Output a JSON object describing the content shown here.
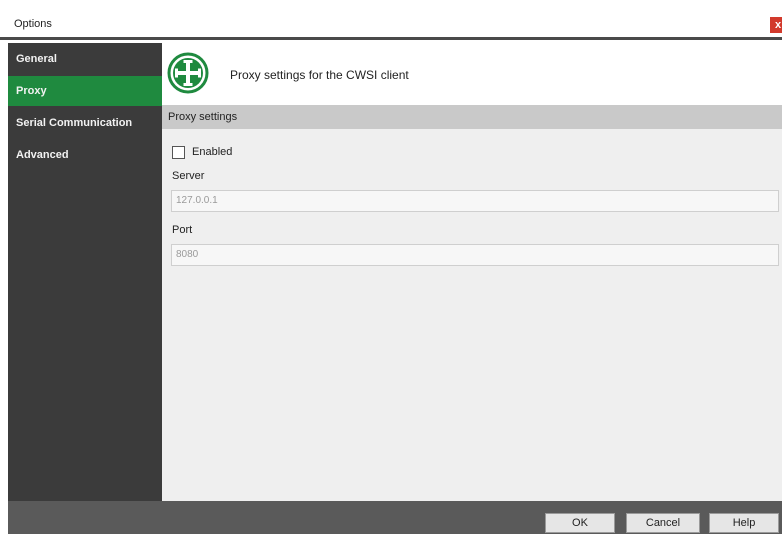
{
  "window": {
    "title": "Options",
    "close_label": "x"
  },
  "sidebar": {
    "items": [
      {
        "label": "General"
      },
      {
        "label": "Proxy"
      },
      {
        "label": "Serial Communication"
      },
      {
        "label": "Advanced"
      }
    ],
    "active_item": "Proxy"
  },
  "header": {
    "title": "Proxy settings for the CWSI client",
    "logo_icon": "green-cross-logo-icon"
  },
  "section": {
    "title": "Proxy settings"
  },
  "form": {
    "enabled_label": "Enabled",
    "enabled_checked": false,
    "server_label": "Server",
    "server_value": "127.0.0.1",
    "port_label": "Port",
    "port_value": "8080"
  },
  "footer": {
    "ok_label": "OK",
    "cancel_label": "Cancel",
    "help_label": "Help"
  },
  "colors": {
    "accent": "#1f8a3f",
    "sidebar": "#3b3b3b",
    "close": "#d23a2c"
  }
}
